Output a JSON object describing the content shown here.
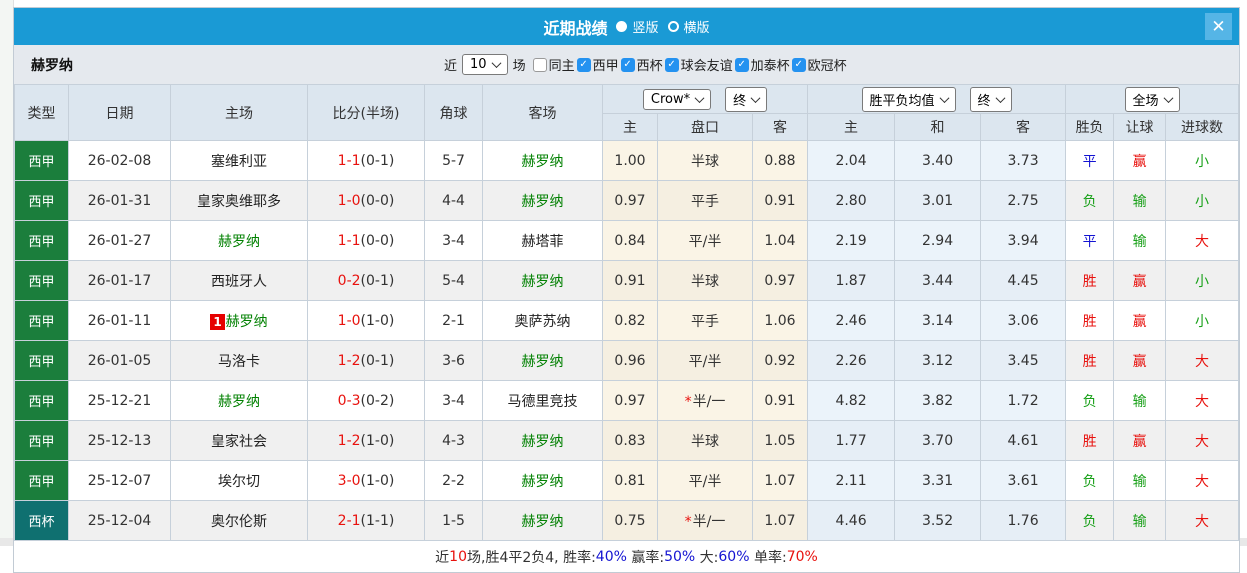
{
  "dialog": {
    "title": "近期战绩",
    "view_options": [
      {
        "label": "竖版",
        "selected": true
      },
      {
        "label": "横版",
        "selected": false
      }
    ]
  },
  "icons": {
    "close": "✕",
    "check": "✓",
    "star": "*"
  },
  "filter_bar": {
    "team_name": "赫罗纳",
    "recent_label": "近",
    "matches_count": "10",
    "matches_label": "场",
    "checkboxes": [
      {
        "label": "同主",
        "checked": false
      },
      {
        "label": "西甲",
        "checked": true
      },
      {
        "label": "西杯",
        "checked": true
      },
      {
        "label": "球会友谊",
        "checked": true
      },
      {
        "label": "加泰杯",
        "checked": true
      },
      {
        "label": "欧冠杯",
        "checked": true
      }
    ]
  },
  "table": {
    "static_headers": [
      "类型",
      "日期",
      "主场",
      "比分(半场)",
      "角球",
      "客场"
    ],
    "group_dropdowns": {
      "asian": [
        "Crow*",
        "终"
      ],
      "european": [
        "胜平负均值",
        "终"
      ],
      "result": [
        "全场"
      ]
    },
    "sub_headers": [
      "主",
      "盘口",
      "客",
      "主",
      "和",
      "客",
      "胜负",
      "让球",
      "进球数"
    ],
    "rows": [
      {
        "league": "西甲",
        "league_color": "#1b7e3c",
        "date": "26-02-08",
        "home": {
          "name": "塞维利亚",
          "highlight": false
        },
        "score_ft": "1-1",
        "score_ht": "(0-1)",
        "corners": "5-7",
        "away": {
          "name": "赫罗纳",
          "highlight": true
        },
        "ah": [
          "1.00",
          "半球",
          "0.88"
        ],
        "ah_star": false,
        "eu": [
          "2.04",
          "3.40",
          "3.73"
        ],
        "outcome": [
          "平",
          "赢",
          "小"
        ]
      },
      {
        "league": "西甲",
        "league_color": "#1b7e3c",
        "date": "26-01-31",
        "home": {
          "name": "皇家奥维耶多",
          "highlight": false
        },
        "score_ft": "1-0",
        "score_ht": "(0-0)",
        "corners": "4-4",
        "away": {
          "name": "赫罗纳",
          "highlight": true
        },
        "ah": [
          "0.97",
          "平手",
          "0.91"
        ],
        "ah_star": false,
        "eu": [
          "2.80",
          "3.01",
          "2.75"
        ],
        "outcome": [
          "负",
          "输",
          "小"
        ]
      },
      {
        "league": "西甲",
        "league_color": "#1b7e3c",
        "date": "26-01-27",
        "home": {
          "name": "赫罗纳",
          "highlight": true
        },
        "score_ft": "1-1",
        "score_ht": "(0-0)",
        "corners": "3-4",
        "away": {
          "name": "赫塔菲",
          "highlight": false
        },
        "ah": [
          "0.84",
          "平/半",
          "1.04"
        ],
        "ah_star": false,
        "eu": [
          "2.19",
          "2.94",
          "3.94"
        ],
        "outcome": [
          "平",
          "输",
          "大"
        ]
      },
      {
        "league": "西甲",
        "league_color": "#1b7e3c",
        "date": "26-01-17",
        "home": {
          "name": "西班牙人",
          "highlight": false
        },
        "score_ft": "0-2",
        "score_ht": "(0-1)",
        "corners": "5-4",
        "away": {
          "name": "赫罗纳",
          "highlight": true
        },
        "ah": [
          "0.91",
          "半球",
          "0.97"
        ],
        "ah_star": false,
        "eu": [
          "1.87",
          "3.44",
          "4.45"
        ],
        "outcome": [
          "胜",
          "赢",
          "小"
        ]
      },
      {
        "league": "西甲",
        "league_color": "#1b7e3c",
        "date": "26-01-11",
        "home": {
          "name": "赫罗纳",
          "highlight": true,
          "badge": "1"
        },
        "score_ft": "1-0",
        "score_ht": "(1-0)",
        "corners": "2-1",
        "away": {
          "name": "奥萨苏纳",
          "highlight": false
        },
        "ah": [
          "0.82",
          "平手",
          "1.06"
        ],
        "ah_star": false,
        "eu": [
          "2.46",
          "3.14",
          "3.06"
        ],
        "outcome": [
          "胜",
          "赢",
          "小"
        ]
      },
      {
        "league": "西甲",
        "league_color": "#1b7e3c",
        "date": "26-01-05",
        "home": {
          "name": "马洛卡",
          "highlight": false
        },
        "score_ft": "1-2",
        "score_ht": "(0-1)",
        "corners": "3-6",
        "away": {
          "name": "赫罗纳",
          "highlight": true
        },
        "ah": [
          "0.96",
          "平/半",
          "0.92"
        ],
        "ah_star": false,
        "eu": [
          "2.26",
          "3.12",
          "3.45"
        ],
        "outcome": [
          "胜",
          "赢",
          "大"
        ]
      },
      {
        "league": "西甲",
        "league_color": "#1b7e3c",
        "date": "25-12-21",
        "home": {
          "name": "赫罗纳",
          "highlight": true
        },
        "score_ft": "0-3",
        "score_ht": "(0-2)",
        "corners": "3-4",
        "away": {
          "name": "马德里竞技",
          "highlight": false
        },
        "ah": [
          "0.97",
          "半/一",
          "0.91"
        ],
        "ah_star": true,
        "eu": [
          "4.82",
          "3.82",
          "1.72"
        ],
        "outcome": [
          "负",
          "输",
          "大"
        ]
      },
      {
        "league": "西甲",
        "league_color": "#1b7e3c",
        "date": "25-12-13",
        "home": {
          "name": "皇家社会",
          "highlight": false
        },
        "score_ft": "1-2",
        "score_ht": "(1-0)",
        "corners": "4-3",
        "away": {
          "name": "赫罗纳",
          "highlight": true
        },
        "ah": [
          "0.83",
          "半球",
          "1.05"
        ],
        "ah_star": false,
        "eu": [
          "1.77",
          "3.70",
          "4.61"
        ],
        "outcome": [
          "胜",
          "赢",
          "大"
        ]
      },
      {
        "league": "西甲",
        "league_color": "#1b7e3c",
        "date": "25-12-07",
        "home": {
          "name": "埃尔切",
          "highlight": false
        },
        "score_ft": "3-0",
        "score_ht": "(1-0)",
        "corners": "2-2",
        "away": {
          "name": "赫罗纳",
          "highlight": true
        },
        "ah": [
          "0.81",
          "平/半",
          "1.07"
        ],
        "ah_star": false,
        "eu": [
          "2.11",
          "3.31",
          "3.61"
        ],
        "outcome": [
          "负",
          "输",
          "大"
        ]
      },
      {
        "league": "西杯",
        "league_color": "#0f7070",
        "date": "25-12-04",
        "home": {
          "name": "奥尔伦斯",
          "highlight": false
        },
        "score_ft": "2-1",
        "score_ht": "(1-1)",
        "corners": "1-5",
        "away": {
          "name": "赫罗纳",
          "highlight": true
        },
        "ah": [
          "0.75",
          "半/一",
          "1.07"
        ],
        "ah_star": true,
        "eu": [
          "4.46",
          "3.52",
          "1.76"
        ],
        "outcome": [
          "负",
          "输",
          "大"
        ]
      }
    ]
  },
  "footer": {
    "segments": [
      {
        "text": "近",
        "color": "#333333"
      },
      {
        "text": "10",
        "color": "#e8120e"
      },
      {
        "text": "场,胜4平2负4, 胜率:",
        "color": "#333333"
      },
      {
        "text": "40%",
        "color": "#1414d2"
      },
      {
        "text": " 赢率:",
        "color": "#333333"
      },
      {
        "text": "50%",
        "color": "#1414d2"
      },
      {
        "text": " 大:",
        "color": "#333333"
      },
      {
        "text": "60%",
        "color": "#1414d2"
      },
      {
        "text": " 单率:",
        "color": "#333333"
      },
      {
        "text": "70%",
        "color": "#e8120e"
      }
    ]
  },
  "colors": {
    "titlebar": "#1a9ad5",
    "close_button": "#55b5e6",
    "filter_bar_bg": "#e5e9ee",
    "header_bg": "#dce6ef",
    "laliga_badge": "#1b7e3c",
    "cup_badge": "#0f7070",
    "team_highlight": "#008000",
    "team_normal": "#222222",
    "score_red": "#e8120e",
    "ah_column_bg": "#faf4e6",
    "eu_column_bg": "#ebf3fa"
  },
  "value_colors": {
    "胜": "#e8120e",
    "平": "#1414d2",
    "负": "#18a018",
    "赢": "#e8120e",
    "输": "#18a018",
    "大": "#e8120e",
    "小": "#18a018"
  }
}
